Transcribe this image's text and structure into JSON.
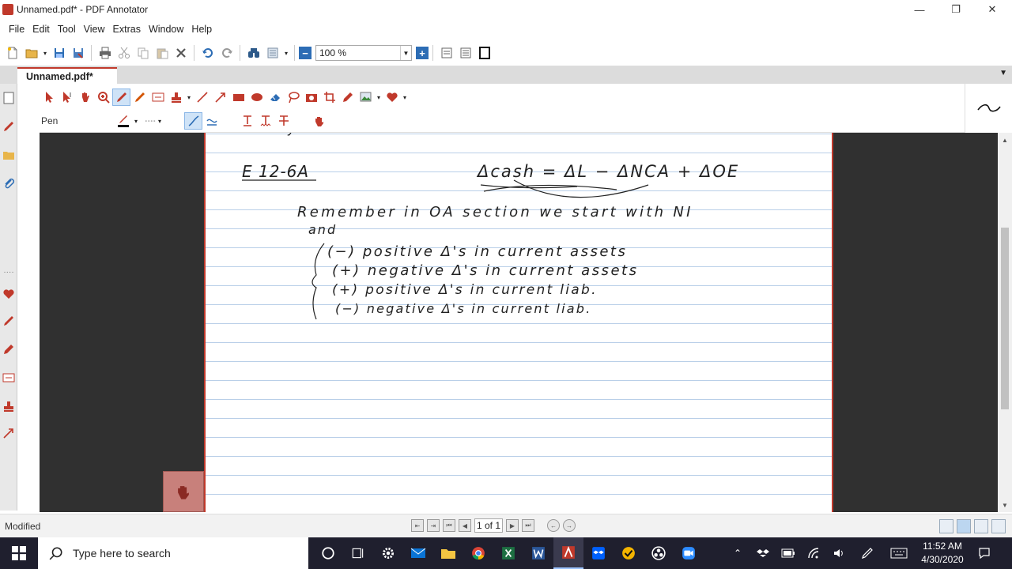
{
  "window": {
    "title": "Unnamed.pdf* - PDF Annotator",
    "minimize": "—",
    "restore": "❐",
    "close": "✕"
  },
  "menu": [
    "File",
    "Edit",
    "Tool",
    "View",
    "Extras",
    "Window",
    "Help"
  ],
  "toolbar": {
    "zoom_value": "100 %",
    "zoom_minus": "−",
    "zoom_plus": "+"
  },
  "tab": {
    "label": "Unnamed.pdf*"
  },
  "annotation_toolbar": {
    "tool_label": "Pen"
  },
  "document": {
    "note_lines": [
      "E 12-6A",
      "Δcash = ΔL − ΔNCA + ΔOE",
      "Remember in OA section we start with NI",
      "and",
      "(−)  positive Δ's in current assets",
      "(+)  negative Δ's in current assets",
      "(+)  positive Δ's in current liab.",
      "(−)  negative Δ's in current liab."
    ]
  },
  "statusbar": {
    "status": "Modified",
    "page_indicator": "1 of 1"
  },
  "taskbar": {
    "search_placeholder": "Type here to search",
    "time": "11:52 AM",
    "date": "4/30/2020"
  },
  "colors": {
    "accent_red": "#c0392b",
    "zoom_blue": "#2d6db5",
    "doc_background": "#303030",
    "rule_line": "#b9cfe8"
  }
}
